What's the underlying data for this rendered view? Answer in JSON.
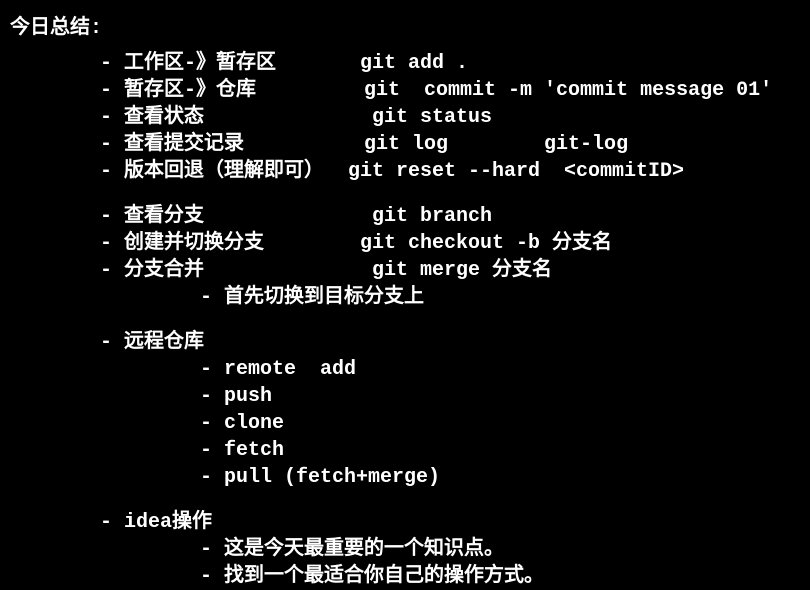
{
  "title": "今日总结:",
  "section1": [
    {
      "label": "- 工作区-》暂存区",
      "cmd": "git add ."
    },
    {
      "label": "- 暂存区-》仓库",
      "cmd": "git  commit -m 'commit message 01'"
    },
    {
      "label": "- 查看状态",
      "cmd": "git status"
    },
    {
      "label": "- 查看提交记录",
      "cmd": "git log        git-log"
    },
    {
      "label": "- 版本回退（理解即可）",
      "cmd": "git reset --hard  <commitID>"
    }
  ],
  "section2": [
    {
      "label": "- 查看分支",
      "cmd": "git branch"
    },
    {
      "label": "- 创建并切换分支",
      "cmd": "git checkout -b 分支名"
    },
    {
      "label": "- 分支合并",
      "cmd": "git merge 分支名"
    }
  ],
  "section2_sub": [
    "- 首先切换到目标分支上"
  ],
  "section3_label": "- 远程仓库",
  "section3_sub": [
    "- remote  add",
    "- push",
    "- clone",
    "- fetch",
    "- pull (fetch+merge)"
  ],
  "section4_label": "- idea操作",
  "section4_sub": [
    "- 这是今天最重要的一个知识点。",
    "- 找到一个最适合你自己的操作方式。"
  ]
}
